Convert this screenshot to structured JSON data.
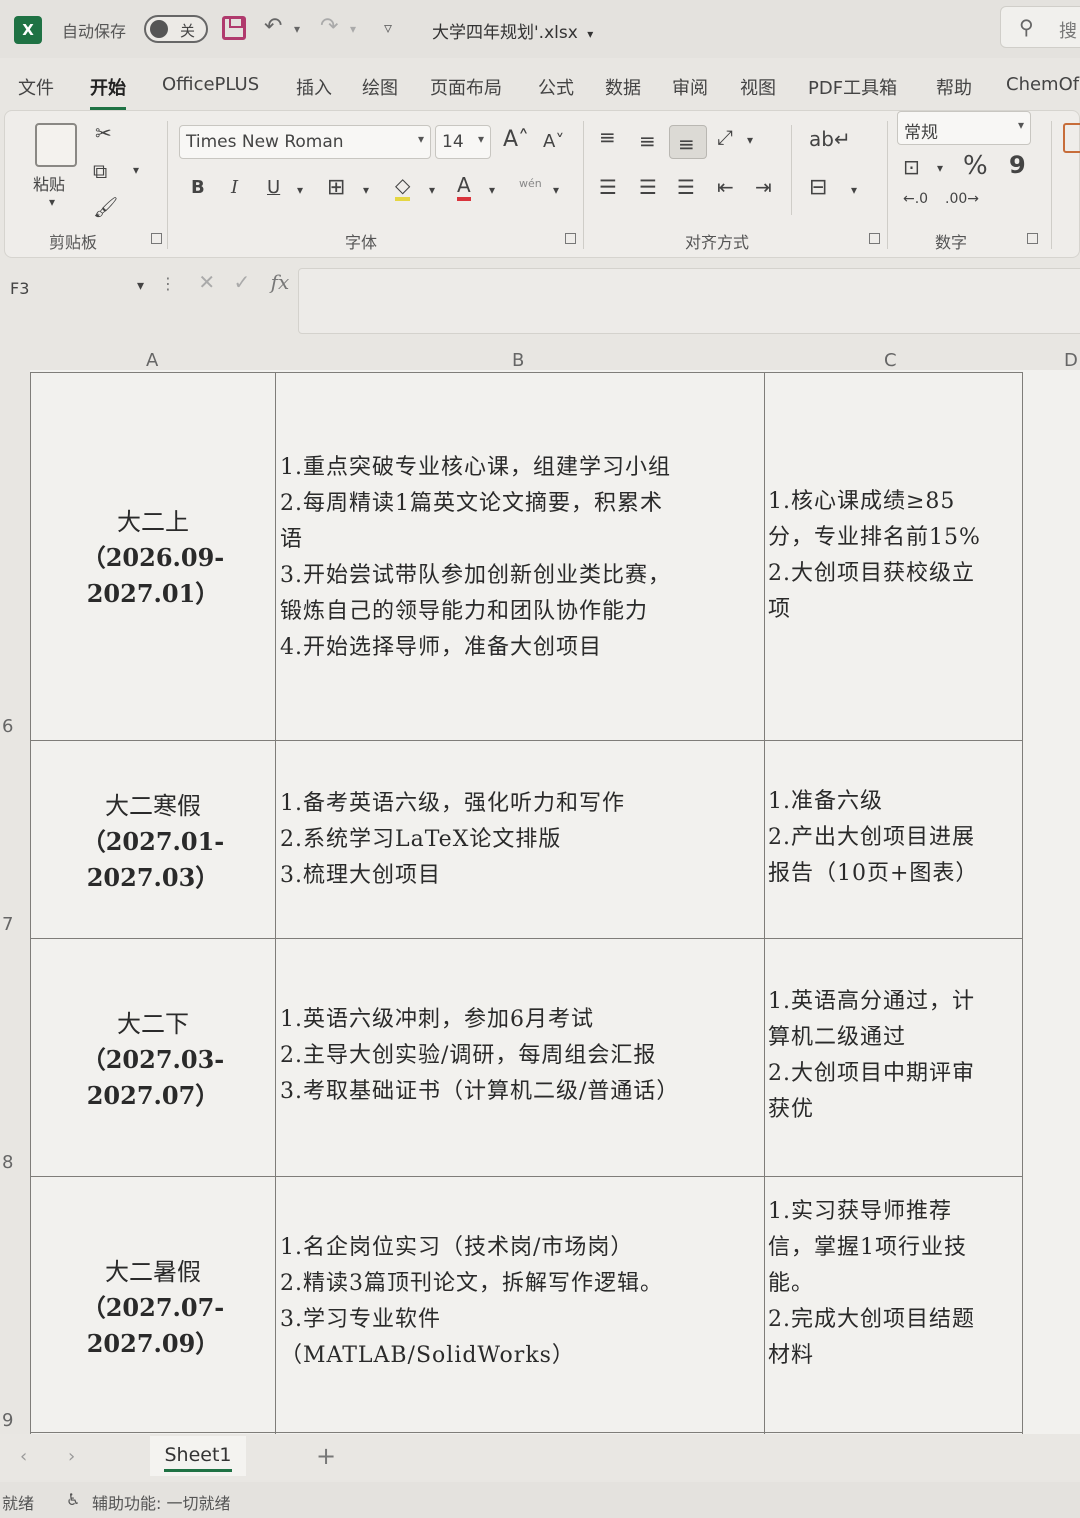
{
  "titlebar": {
    "autosave_label": "自动保存",
    "autosave_state": "关",
    "document_title": "大学四年规划'.xlsx",
    "search_text": "搜"
  },
  "tabs": [
    "文件",
    "开始",
    "OfficePLUS",
    "插入",
    "绘图",
    "页面布局",
    "公式",
    "数据",
    "审阅",
    "视图",
    "PDF工具箱",
    "帮助",
    "ChemOf"
  ],
  "active_tab": "开始",
  "ribbon": {
    "clipboard": {
      "paste_label": "粘贴",
      "group_label": "剪贴板"
    },
    "font": {
      "font_name": "Times New Roman",
      "font_size": "14",
      "bold": "B",
      "italic": "I",
      "underline": "U",
      "group_label": "字体"
    },
    "alignment": {
      "group_label": "对齐方式"
    },
    "number": {
      "format": "常规",
      "percent": "%",
      "comma": "9",
      "group_label": "数字"
    }
  },
  "formula_bar": {
    "cell_ref": "F3",
    "fx": "fx"
  },
  "columns": [
    "A",
    "B",
    "C",
    "D"
  ],
  "rows": [
    {
      "row_number": "6",
      "period": "大二上",
      "date_range": [
        "（2026.09-",
        "2027.01）"
      ],
      "plan": [
        "1.重点突破专业核心课，组建学习小组",
        "2.每周精读1篇英文论文摘要，积累术",
        "语",
        "3.开始尝试带队参加创新创业类比赛，",
        "锻炼自己的领导能力和团队协作能力",
        "4.开始选择导师，准备大创项目"
      ],
      "goals": [
        "1.核心课成绩≥85",
        "分，专业排名前15%",
        "2.大创项目获校级立",
        "项"
      ]
    },
    {
      "row_number": "7",
      "period": "大二寒假",
      "date_range": [
        "（2027.01-",
        "2027.03）"
      ],
      "plan": [
        "1.备考英语六级，强化听力和写作",
        "2.系统学习LaTeX论文排版",
        "3.梳理大创项目"
      ],
      "goals": [
        "1.准备六级",
        "2.产出大创项目进展",
        "报告（10页+图表）"
      ]
    },
    {
      "row_number": "8",
      "period": "大二下",
      "date_range": [
        "（2027.03-",
        "2027.07）"
      ],
      "plan": [
        "1.英语六级冲刺，参加6月考试",
        "2.主导大创实验/调研，每周组会汇报",
        "3.考取基础证书（计算机二级/普通话）"
      ],
      "goals": [
        "1.英语高分通过，计",
        "算机二级通过",
        "2.大创项目中期评审",
        "获优"
      ]
    },
    {
      "row_number": "9",
      "period": "大二暑假",
      "date_range": [
        "（2027.07-",
        "2027.09）"
      ],
      "plan": [
        "1.名企岗位实习（技术岗/市场岗）",
        "2.精读3篇顶刊论文，拆解写作逻辑。",
        "3.学习专业软件",
        "（MATLAB/SolidWorks）"
      ],
      "goals": [
        "1.实习获导师推荐",
        "信，掌握1项行业技",
        "能。",
        "2.完成大创项目结题",
        "材料"
      ]
    }
  ],
  "sheet_tabs": {
    "active": "Sheet1",
    "add": "+"
  },
  "status_bar": {
    "ready": "就绪",
    "accessibility": "辅助功能: 一切就绪"
  }
}
